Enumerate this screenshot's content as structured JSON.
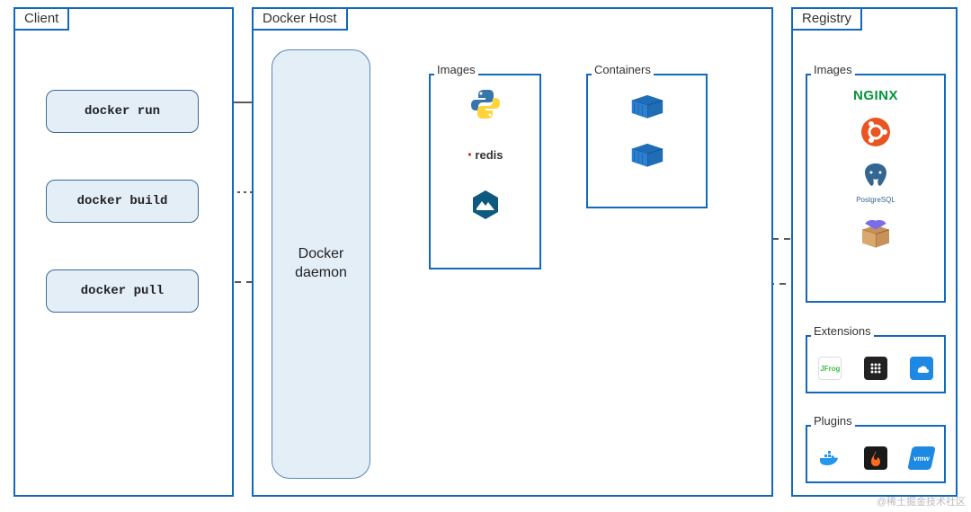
{
  "client": {
    "title": "Client",
    "commands": {
      "run": "docker run",
      "build": "docker build",
      "pull": "docker pull"
    }
  },
  "host": {
    "title": "Docker Host",
    "daemon_label": "Docker\ndaemon",
    "images_label": "Images",
    "containers_label": "Containers",
    "images": [
      "python",
      "redis",
      "alpine"
    ]
  },
  "registry": {
    "title": "Registry",
    "images_label": "Images",
    "extensions_label": "Extensions",
    "plugins_label": "Plugins",
    "images": [
      "NGINX",
      "ubuntu",
      "PostgreSQL",
      "package"
    ],
    "extensions": [
      "JFrog",
      "grid",
      "azure"
    ],
    "plugins": [
      "docker",
      "flame",
      "vmw"
    ]
  },
  "redis_text": "redis",
  "pg_text": "PostgreSQL",
  "watermark": "@稀土掘金技术社区"
}
